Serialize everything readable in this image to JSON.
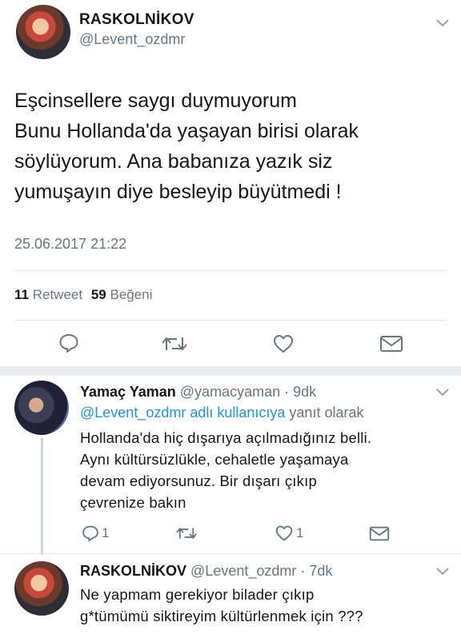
{
  "main_tweet": {
    "display_name": "RASKOLNİKOV",
    "handle": "@Levent_ozdmr",
    "text_lines": [
      "Eşcinsellere saygı duymuyorum",
      "Bunu Hollanda'da yaşayan birisi olarak",
      "söylüyorum. Ana babanıza yazık siz",
      "yumuşayın diye besleyip büyütmedi !"
    ],
    "timestamp": "25.06.2017 21:22",
    "stats": {
      "retweet_count": "11",
      "retweet_label": "Retweet",
      "like_count": "59",
      "like_label": "Beğeni"
    }
  },
  "replies": [
    {
      "display_name": "Yamaç Yaman",
      "handle": "@yamacyaman",
      "time": "· 9dk",
      "reply_to_mention": "@Levent_ozdmr adlı kullanıcıya",
      "reply_to_suffix": "yanıt olarak",
      "text_lines": [
        "Hollanda'da hiç dışarıya açılmadığınız belli.",
        "Aynı kültürsüzlükle, cehaletle yaşamaya",
        "devam ediyorsunuz. Bir dışarı çıkıp",
        "çevrenize bakın"
      ],
      "reply_count": "1",
      "like_count": "1"
    },
    {
      "display_name": "RASKOLNİKOV",
      "handle": "@Levent_ozdmr",
      "time": "· 7dk",
      "text_lines": [
        "Ne yapmam gerekiyor bilader çıkıp",
        "g*tümümü siktireyim kültürlenmek için  ???"
      ]
    }
  ],
  "icons": {
    "reply": "speech-bubble-icon",
    "retweet": "retweet-arrows-icon",
    "like": "heart-icon",
    "dm": "envelope-icon",
    "menu": "chevron-down-icon"
  },
  "colors": {
    "text": "#14171a",
    "secondary": "#657786",
    "link": "#1b95e0",
    "divider": "#e1e8ed"
  }
}
